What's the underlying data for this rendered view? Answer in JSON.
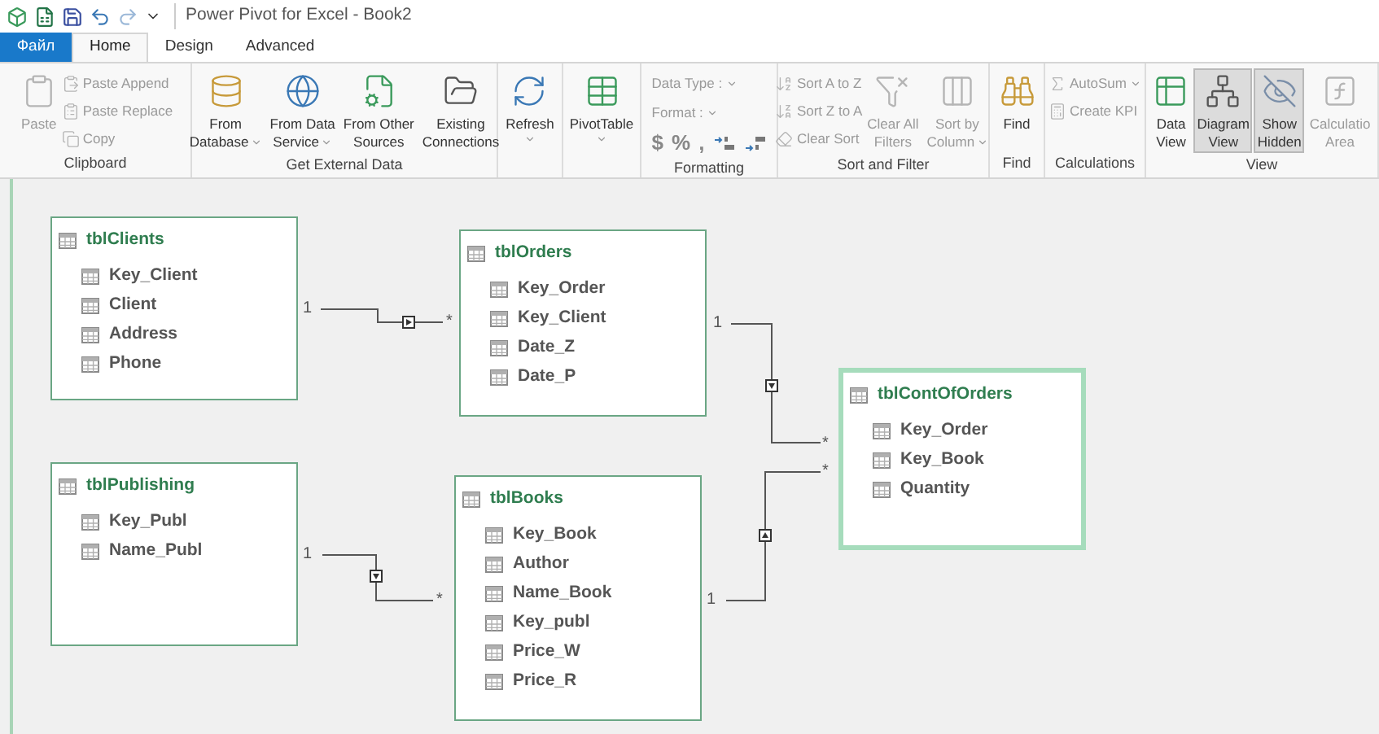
{
  "title_bar": {
    "title": "Power Pivot for Excel - Book2"
  },
  "tabs": [
    {
      "label": "Файл",
      "kind": "file",
      "selected": false
    },
    {
      "label": "Home",
      "kind": "tab",
      "selected": true
    },
    {
      "label": "Design",
      "kind": "tab",
      "selected": false
    },
    {
      "label": "Advanced",
      "kind": "tab",
      "selected": false
    }
  ],
  "ribbon": [
    {
      "label": "Clipboard",
      "items": [
        {
          "kind": "large",
          "lines": [
            "Paste"
          ],
          "disabled": true,
          "dropdown": false
        },
        {
          "kind": "small",
          "lines": [
            "Paste Append"
          ],
          "disabled": true,
          "dropdown": false
        },
        {
          "kind": "small",
          "lines": [
            "Paste Replace"
          ],
          "disabled": true,
          "dropdown": false
        },
        {
          "kind": "small",
          "lines": [
            "Copy"
          ],
          "disabled": true,
          "dropdown": false
        }
      ]
    },
    {
      "label": "Get External Data",
      "items": [
        {
          "kind": "large",
          "lines": [
            "From",
            "Database"
          ],
          "disabled": false,
          "dropdown": true
        },
        {
          "kind": "large",
          "lines": [
            "From Data",
            "Service"
          ],
          "disabled": false,
          "dropdown": true
        },
        {
          "kind": "large",
          "lines": [
            "From Other",
            "Sources"
          ],
          "disabled": false,
          "dropdown": false
        },
        {
          "kind": "large",
          "lines": [
            "Existing",
            "Connections"
          ],
          "disabled": false,
          "dropdown": false
        }
      ]
    },
    {
      "items": [
        {
          "kind": "large",
          "lines": [
            "Refresh"
          ],
          "disabled": false,
          "dropdown": true
        }
      ]
    },
    {
      "items": [
        {
          "kind": "large",
          "lines": [
            "PivotTable"
          ],
          "disabled": false,
          "dropdown": true
        }
      ]
    },
    {
      "label": "Formatting",
      "items": [
        {
          "kind": "field",
          "lines": [
            "Data Type :"
          ],
          "disabled": true,
          "dropdown": true
        },
        {
          "kind": "field",
          "lines": [
            "Format :"
          ],
          "disabled": true,
          "dropdown": true
        },
        {
          "kind": "symbols",
          "symbols": [
            "$",
            "%",
            ","
          ],
          "disabled": true
        }
      ]
    },
    {
      "label": "Sort and Filter",
      "items": [
        {
          "kind": "small",
          "lines": [
            "Sort A to Z"
          ],
          "disabled": true,
          "dropdown": false
        },
        {
          "kind": "small",
          "lines": [
            "Sort Z to A"
          ],
          "disabled": true,
          "dropdown": false
        },
        {
          "kind": "small",
          "lines": [
            "Clear Sort"
          ],
          "disabled": true,
          "dropdown": false
        },
        {
          "kind": "large",
          "lines": [
            "Clear All",
            "Filters"
          ],
          "disabled": true,
          "dropdown": false
        },
        {
          "kind": "large",
          "lines": [
            "Sort by",
            "Column"
          ],
          "disabled": true,
          "dropdown": true
        }
      ]
    },
    {
      "label": "Find",
      "items": [
        {
          "kind": "large",
          "lines": [
            "Find"
          ],
          "disabled": false,
          "dropdown": false
        }
      ]
    },
    {
      "label": "Calculations",
      "items": [
        {
          "kind": "small",
          "lines": [
            "AutoSum"
          ],
          "disabled": true,
          "dropdown": true
        },
        {
          "kind": "small",
          "lines": [
            "Create KPI"
          ],
          "disabled": true,
          "dropdown": false
        }
      ]
    },
    {
      "label": "View",
      "items": [
        {
          "kind": "large",
          "lines": [
            "Data",
            "View"
          ],
          "disabled": false,
          "dropdown": false,
          "pressed": false
        },
        {
          "kind": "large",
          "lines": [
            "Diagram",
            "View"
          ],
          "disabled": false,
          "dropdown": false,
          "pressed": true
        },
        {
          "kind": "large",
          "lines": [
            "Show",
            "Hidden"
          ],
          "disabled": false,
          "dropdown": false,
          "pressed": true
        },
        {
          "kind": "large",
          "lines": [
            "Calculatio",
            "Area"
          ],
          "disabled": true,
          "dropdown": false,
          "pressed": false
        }
      ]
    }
  ],
  "diagram": {
    "tables": [
      {
        "name": "tblClients",
        "selected": false,
        "columns": [
          "Key_Client",
          "Client",
          "Address",
          "Phone"
        ]
      },
      {
        "name": "tblOrders",
        "selected": false,
        "columns": [
          "Key_Order",
          "Key_Client",
          "Date_Z",
          "Date_P"
        ]
      },
      {
        "name": "tblContOfOrders",
        "selected": true,
        "columns": [
          "Key_Order",
          "Key_Book",
          "Quantity"
        ]
      },
      {
        "name": "tblPublishing",
        "selected": false,
        "columns": [
          "Key_Publ",
          "Name_Publ"
        ]
      },
      {
        "name": "tblBooks",
        "selected": false,
        "columns": [
          "Key_Book",
          "Author",
          "Name_Book",
          "Key_publ",
          "Price_W",
          "Price_R"
        ]
      }
    ],
    "relationships": [
      {
        "one_label": "1",
        "many_label": "*"
      },
      {
        "one_label": "1",
        "many_label": "*"
      },
      {
        "one_label": "1",
        "many_label": "*"
      },
      {
        "one_label": "1",
        "many_label": "*"
      }
    ]
  }
}
